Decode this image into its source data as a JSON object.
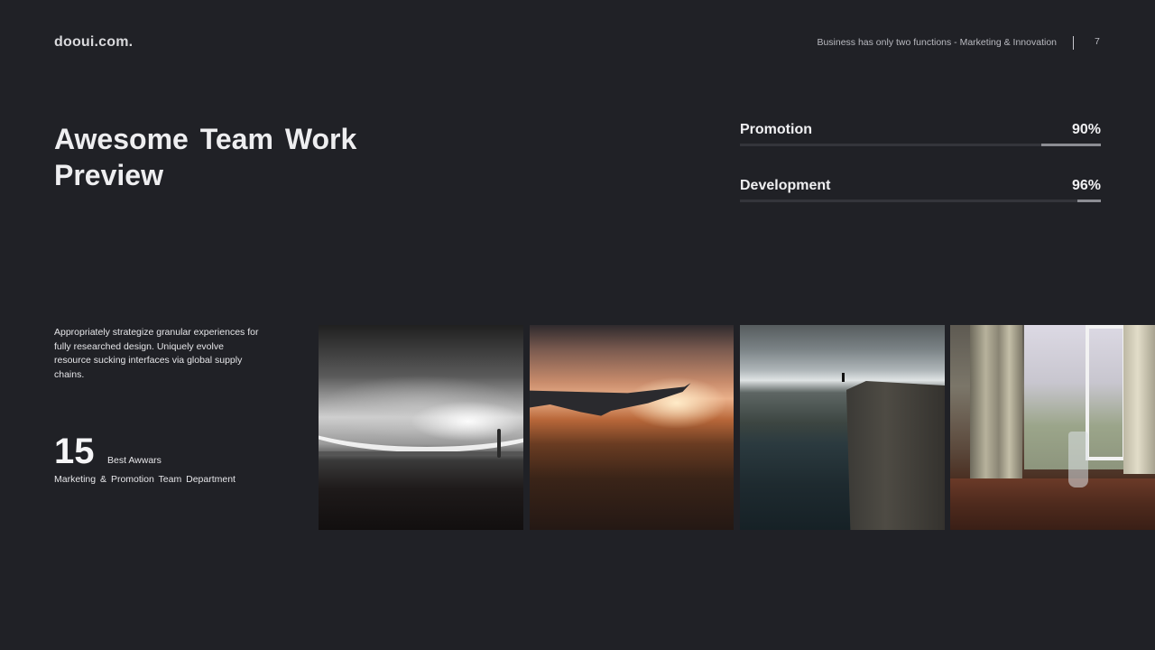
{
  "header": {
    "brand": "dooui.com.",
    "tagline": "Business has only two functions - Marketing & Innovation",
    "page_number": "7"
  },
  "main": {
    "title": "Awesome Team Work Preview",
    "skills": [
      {
        "label": "Promotion",
        "value_text": "90%",
        "percent": 90
      },
      {
        "label": "Development",
        "value_text": "96%",
        "percent": 96
      }
    ],
    "description": "Appropriately strategize granular experiences for fully researched design. Uniquely evolve resource sucking interfaces via global supply chains.",
    "awards": {
      "number": "15",
      "label": "Best Awwars",
      "caption": "Marketing & Promotion Team Department"
    }
  },
  "gallery": [
    {
      "subject": "black-and-white light arc over landscape with lone figure"
    },
    {
      "subject": "airplane wing at sunset"
    },
    {
      "subject": "person standing on cliff above fjord"
    },
    {
      "subject": "window with curtains and plant in glass vase"
    }
  ],
  "colors": {
    "background": "#202126",
    "text": "#eeeef0",
    "track": "#34353b",
    "fill": "#8c8d93"
  }
}
